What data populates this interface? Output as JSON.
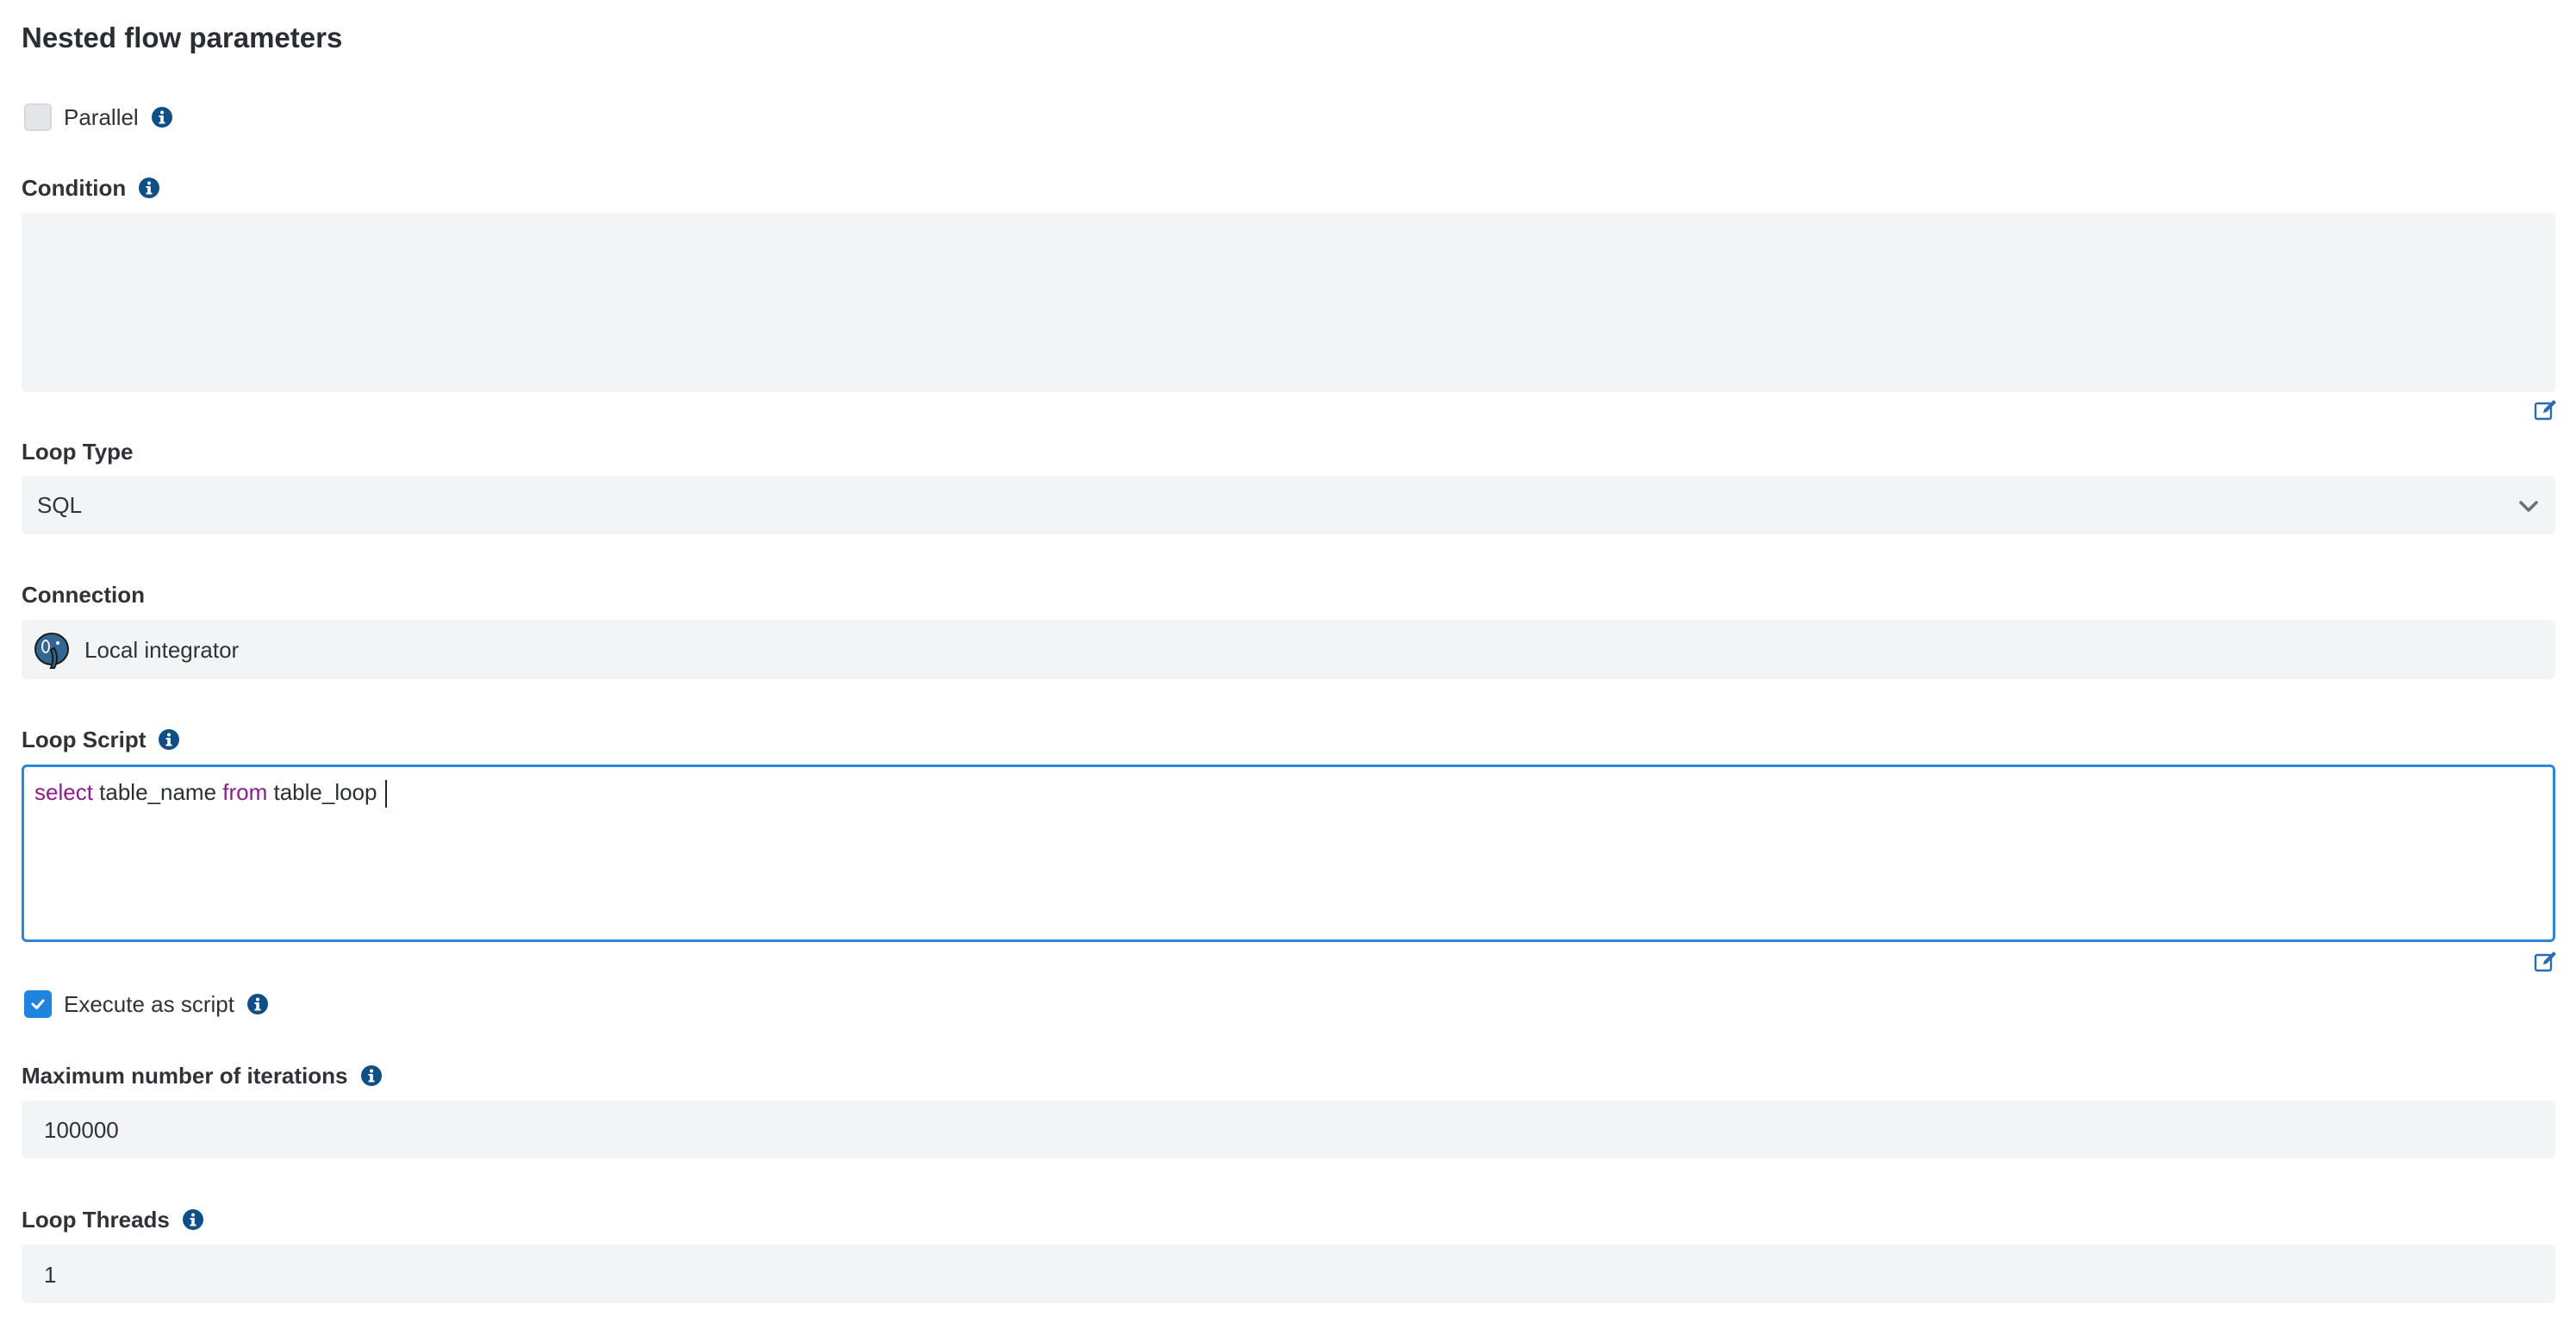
{
  "title": "Nested flow parameters",
  "parallel": {
    "label": "Parallel",
    "checked": false
  },
  "condition": {
    "label": "Condition",
    "value": ""
  },
  "loop_type": {
    "label": "Loop Type",
    "value": "SQL"
  },
  "connection": {
    "label": "Connection",
    "value": "Local integrator",
    "icon": "postgresql-elephant-icon"
  },
  "loop_script": {
    "label": "Loop Script",
    "tokens": [
      {
        "text": "select",
        "kw": true
      },
      {
        "text": " table_name ",
        "kw": false
      },
      {
        "text": "from",
        "kw": true
      },
      {
        "text": " table_loop ",
        "kw": false
      }
    ]
  },
  "execute_as_script": {
    "label": "Execute as script",
    "checked": true
  },
  "max_iterations": {
    "label": "Maximum number of iterations",
    "value": "100000"
  },
  "loop_threads": {
    "label": "Loop Threads",
    "value": "1"
  },
  "colors": {
    "accent": "#1f84e0",
    "info": "#0f4f86",
    "keyword": "#8b1d8b",
    "field_bg": "#f3f4f5"
  }
}
